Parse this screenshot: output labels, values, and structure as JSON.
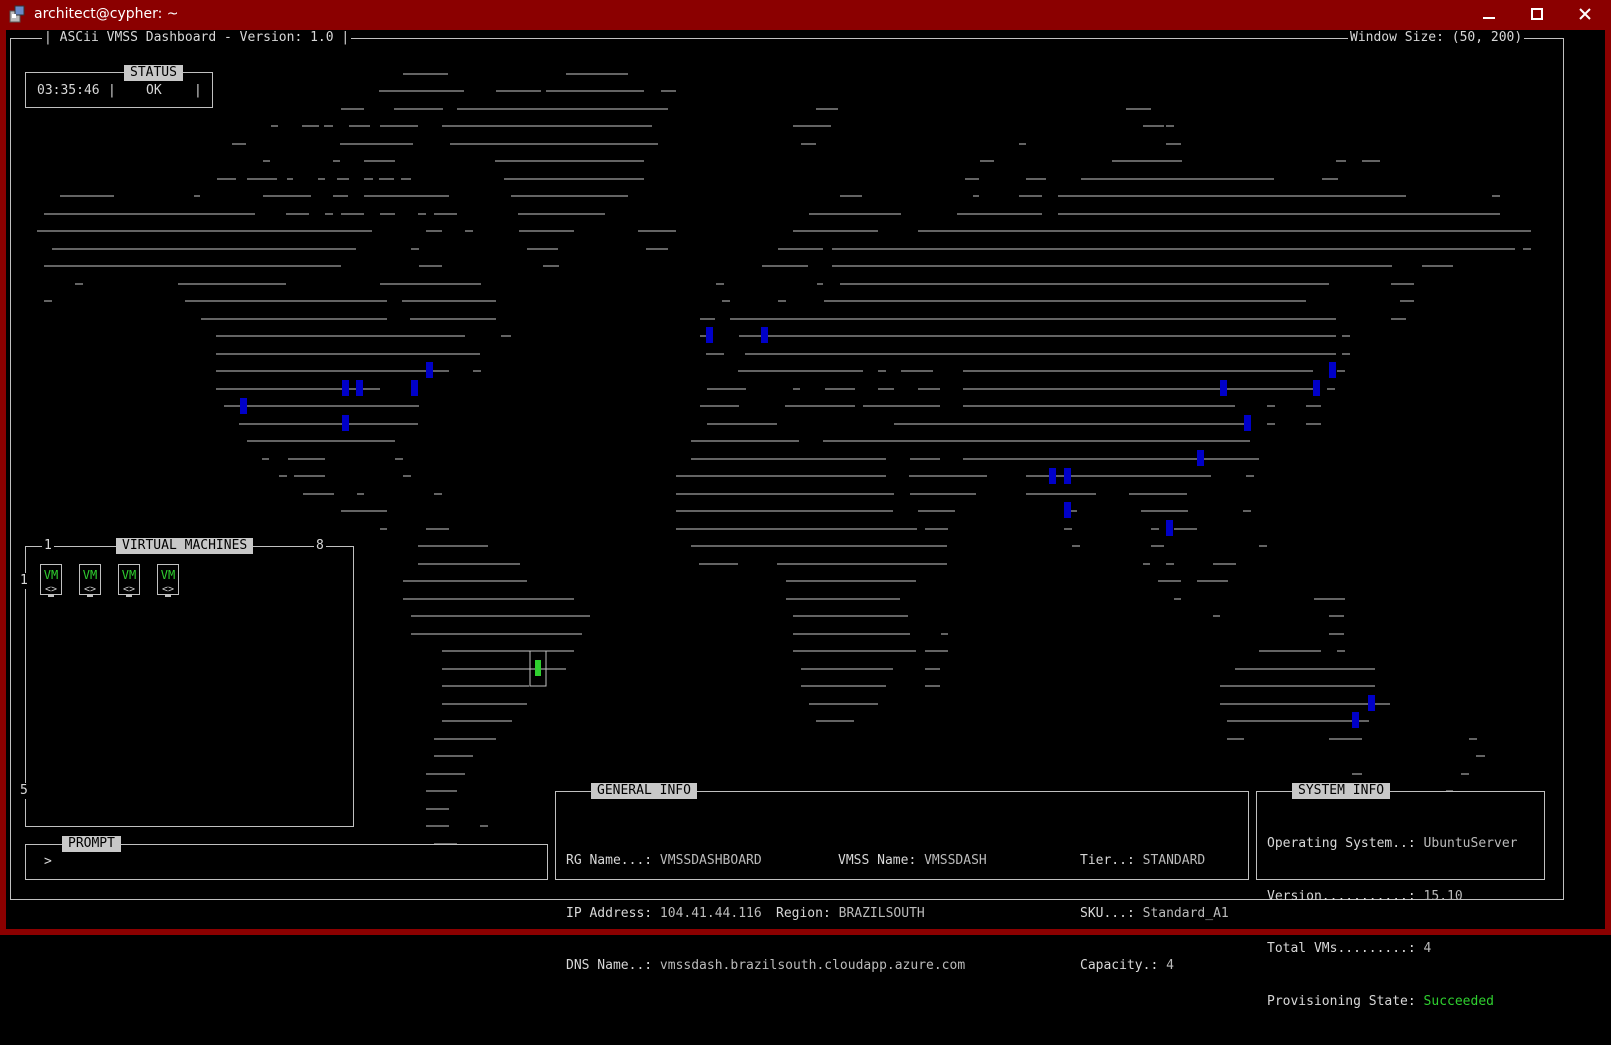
{
  "window": {
    "title": "architect@cypher: ~",
    "buttons": {
      "minimize": "—",
      "maximize": "□",
      "close": "✕"
    }
  },
  "dashboard": {
    "header_title": "| ASCii VMSS Dashboard - Version: 1.0 |",
    "window_size": "Window Size: (50, 200)"
  },
  "status": {
    "title": "STATUS",
    "time": "03:35:46",
    "separator": "|",
    "state": "OK"
  },
  "virtual_machines": {
    "title": "VIRTUAL MACHINES",
    "col_start": "1",
    "col_end": "8",
    "row_start": "1",
    "row_end": "5",
    "vms": [
      {
        "label": "VM",
        "tag": "<>"
      },
      {
        "label": "VM",
        "tag": "<>"
      },
      {
        "label": "VM",
        "tag": "<>"
      },
      {
        "label": "VM",
        "tag": "<>"
      }
    ]
  },
  "prompt": {
    "title": "PROMPT",
    "symbol": ">"
  },
  "general_info": {
    "title": "GENERAL INFO",
    "rg_name_label": "RG Name...:",
    "rg_name": "VMSSDASHBOARD",
    "vmss_name_label": "VMSS Name:",
    "vmss_name": "VMSSDASH",
    "tier_label": "Tier..:",
    "tier": "STANDARD",
    "ip_label": "IP Address:",
    "ip": "104.41.44.116",
    "region_label": "Region:",
    "region": "BRAZILSOUTH",
    "sku_label": "SKU...:",
    "sku": "Standard_A1",
    "dns_label": "DNS Name..:",
    "dns": "vmssdash.brazilsouth.cloudapp.azure.com",
    "capacity_label": "Capacity.:",
    "capacity": "4"
  },
  "system_info": {
    "title": "SYSTEM INFO",
    "os_label": "Operating System..:",
    "os": "UbuntuServer",
    "version_label": "Version...........:",
    "version": "15.10",
    "total_vms_label": "Total VMs.........:",
    "total_vms": "4",
    "prov_label": "Provisioning State:",
    "prov": "Succeeded"
  },
  "colors": {
    "titlebar": "#8b0000",
    "datacenter_marker": "#0000c8",
    "active_region_marker": "#2fd02f",
    "map_lines": "#c8c8c8"
  }
}
